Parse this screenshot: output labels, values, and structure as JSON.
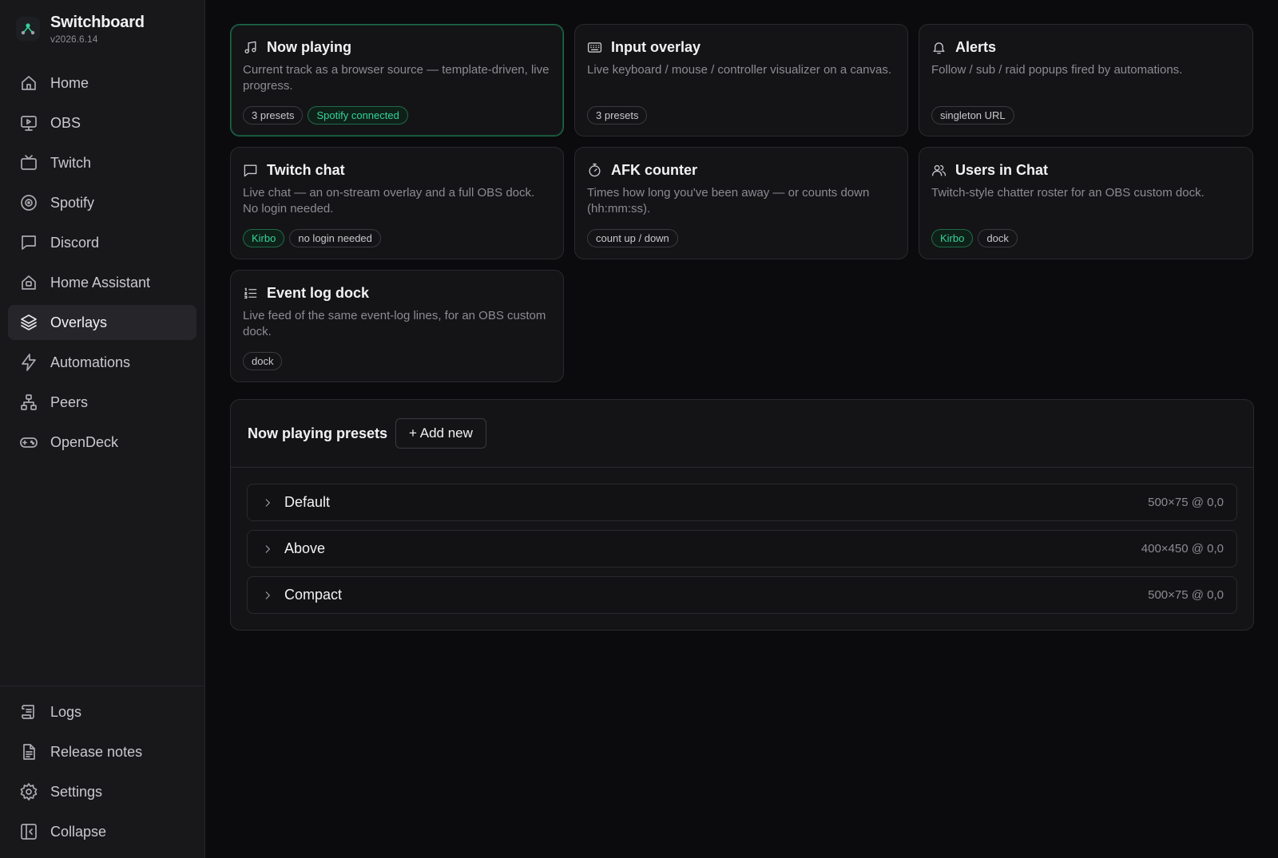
{
  "brand": {
    "name": "Switchboard",
    "version": "v2026.6.14"
  },
  "nav": {
    "items": [
      {
        "label": "Home",
        "icon": "home-icon"
      },
      {
        "label": "OBS",
        "icon": "monitor-icon"
      },
      {
        "label": "Twitch",
        "icon": "tv-icon"
      },
      {
        "label": "Spotify",
        "icon": "spotify-icon"
      },
      {
        "label": "Discord",
        "icon": "chat-icon"
      },
      {
        "label": "Home Assistant",
        "icon": "home-assistant-icon"
      },
      {
        "label": "Overlays",
        "icon": "layers-icon",
        "active": true
      },
      {
        "label": "Automations",
        "icon": "lightning-icon"
      },
      {
        "label": "Peers",
        "icon": "network-icon"
      },
      {
        "label": "OpenDeck",
        "icon": "gamepad-icon"
      }
    ],
    "bottom": [
      {
        "label": "Logs",
        "icon": "scroll-icon"
      },
      {
        "label": "Release notes",
        "icon": "document-icon"
      },
      {
        "label": "Settings",
        "icon": "gear-icon"
      },
      {
        "label": "Collapse",
        "icon": "collapse-icon"
      }
    ]
  },
  "cards": [
    {
      "title": "Now playing",
      "icon": "music-note-icon",
      "desc": "Current track as a browser source — template-driven, live progress.",
      "selected": true,
      "tags": [
        {
          "label": "3 presets",
          "tone": "neutral"
        },
        {
          "label": "Spotify connected",
          "tone": "green"
        }
      ]
    },
    {
      "title": "Input overlay",
      "icon": "keyboard-icon",
      "desc": "Live keyboard / mouse / controller visualizer on a canvas.",
      "tags": [
        {
          "label": "3 presets",
          "tone": "neutral"
        }
      ]
    },
    {
      "title": "Alerts",
      "icon": "bell-icon",
      "desc": "Follow / sub / raid popups fired by automations.",
      "tags": [
        {
          "label": "singleton URL",
          "tone": "neutral"
        }
      ]
    },
    {
      "title": "Twitch chat",
      "icon": "message-square-icon",
      "desc": "Live chat — an on-stream overlay and a full OBS dock. No login needed.",
      "tags": [
        {
          "label": "Kirbo",
          "tone": "green"
        },
        {
          "label": "no login needed",
          "tone": "neutral"
        }
      ]
    },
    {
      "title": "AFK counter",
      "icon": "stopwatch-icon",
      "desc": "Times how long you've been away — or counts down (hh:mm:ss).",
      "tags": [
        {
          "label": "count up / down",
          "tone": "neutral"
        }
      ]
    },
    {
      "title": "Users in Chat",
      "icon": "users-icon",
      "desc": "Twitch-style chatter roster for an OBS custom dock.",
      "tags": [
        {
          "label": "Kirbo",
          "tone": "green"
        },
        {
          "label": "dock",
          "tone": "neutral"
        }
      ]
    },
    {
      "title": "Event log dock",
      "icon": "list-icon",
      "desc": "Live feed of the same event-log lines, for an OBS custom dock.",
      "tags": [
        {
          "label": "dock",
          "tone": "neutral"
        }
      ]
    }
  ],
  "presets": {
    "title": "Now playing presets",
    "add_label": "+ Add new",
    "items": [
      {
        "name": "Default",
        "meta": "500×75 @ 0,0"
      },
      {
        "name": "Above",
        "meta": "400×450 @ 0,0"
      },
      {
        "name": "Compact",
        "meta": "500×75 @ 0,0"
      }
    ]
  },
  "colors": {
    "accent": "#34d399",
    "accent_border": "#1f6b4a",
    "background": "#0b0b0d",
    "sidebar": "#18181b",
    "card": "#141416"
  }
}
